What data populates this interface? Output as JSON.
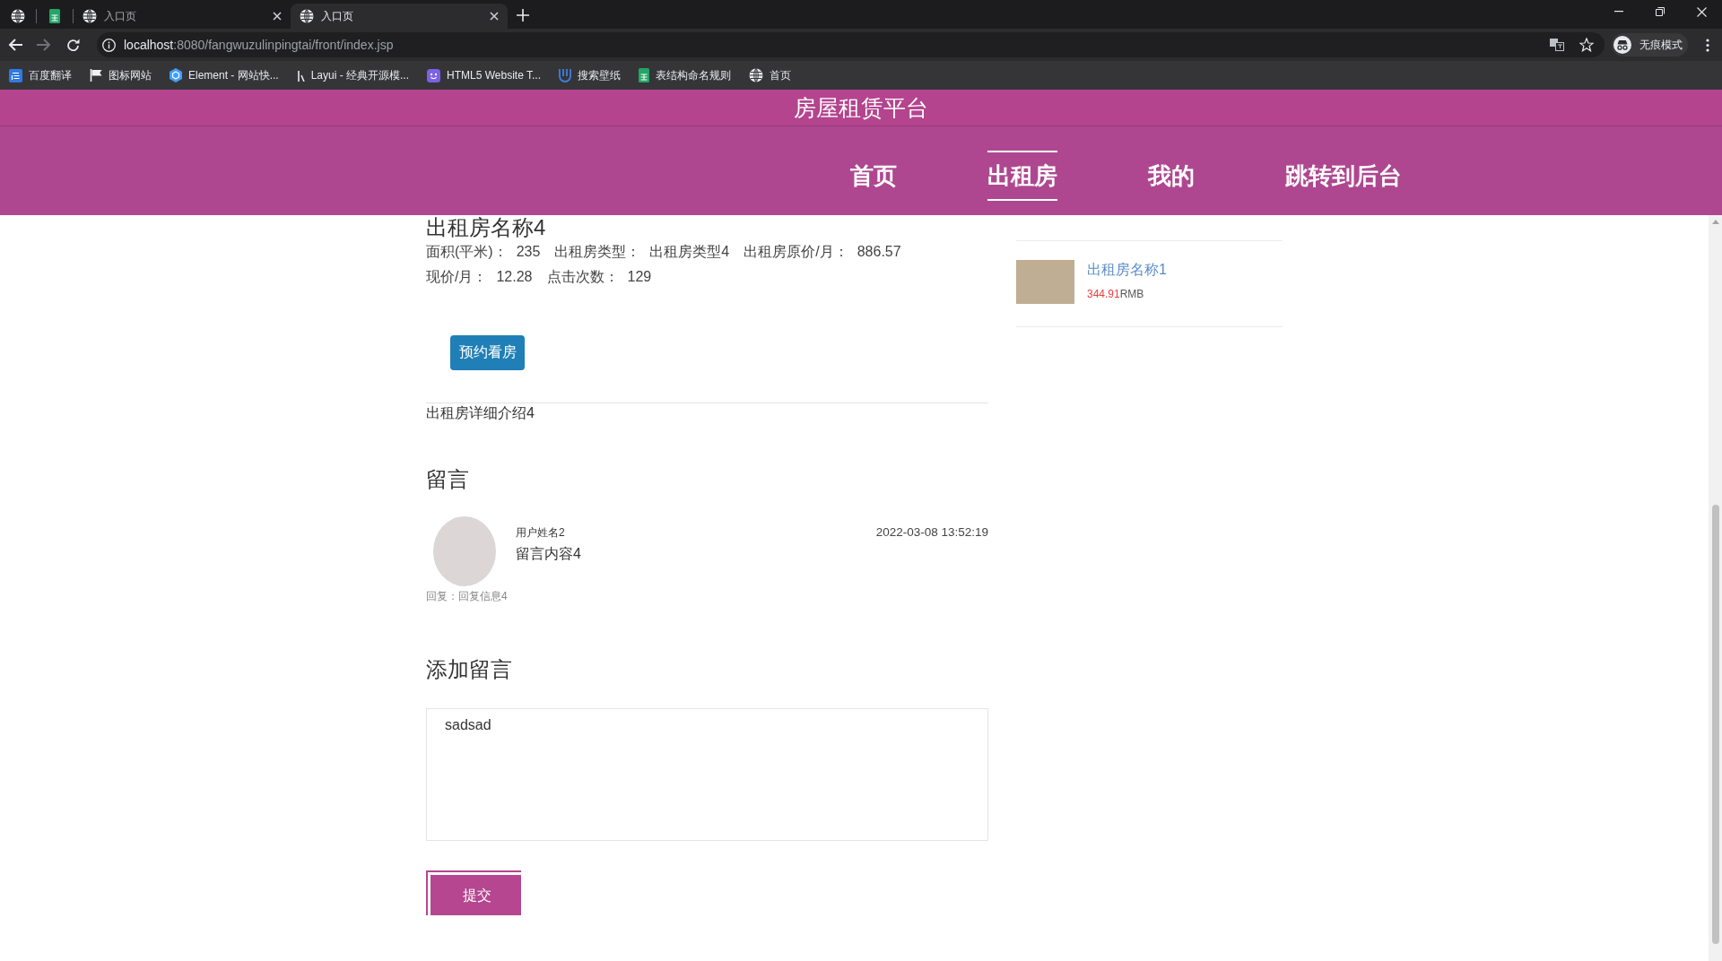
{
  "browser": {
    "tabs": [
      {
        "kind": "pinned",
        "selected": false
      },
      {
        "kind": "pinned",
        "selected": false
      },
      {
        "kind": "page",
        "title": "入口页",
        "selected": false
      },
      {
        "kind": "page",
        "title": "入口页",
        "selected": true
      }
    ],
    "forward_disabled": true,
    "url": {
      "host": "localhost",
      "path": ":8080/fangwuzulinpingtai/front/index.jsp"
    },
    "profile_label": "无痕模式",
    "bookmarks": [
      {
        "label": "百度翻译"
      },
      {
        "label": "图标网站"
      },
      {
        "label": "Element - 网站快..."
      },
      {
        "label": "Layui - 经典开源模..."
      },
      {
        "label": "HTML5 Website T..."
      },
      {
        "label": "搜索壁纸"
      },
      {
        "label": "表结构命名规则"
      },
      {
        "label": "首页"
      }
    ]
  },
  "header": {
    "title": "房屋租赁平台",
    "nav": [
      {
        "label": "首页",
        "selected": false
      },
      {
        "label": "出租房",
        "selected": true
      },
      {
        "label": "我的",
        "selected": false
      },
      {
        "label": "跳转到后台",
        "selected": false
      }
    ]
  },
  "detail": {
    "title": "出租房名称4",
    "info_rows": [
      {
        "fields": [
          {
            "label": "面积(平米)：",
            "value": "235"
          },
          {
            "label": "出租房类型：",
            "value": "出租房类型4"
          },
          {
            "label": "出租房原价/月：",
            "value": "886.57"
          }
        ]
      },
      {
        "fields": [
          {
            "label": "现价/月：",
            "value": "12.28"
          },
          {
            "label": "点击次数：",
            "value": "129"
          }
        ]
      }
    ],
    "book_button": "预约看房",
    "description": "出租房详细介绍4"
  },
  "comments": {
    "heading": "留言",
    "items": [
      {
        "user": "用户姓名2",
        "time": "2022-03-08 13:52:19",
        "content": "留言内容4",
        "reply": "回复：回复信息4"
      }
    ]
  },
  "add_comment": {
    "heading": "添加留言",
    "value": "sadsad",
    "submit": "提交"
  },
  "sidebar": {
    "items": [
      {
        "title": "出租房名称1",
        "price": "344.91",
        "currency": "RMB"
      }
    ]
  }
}
